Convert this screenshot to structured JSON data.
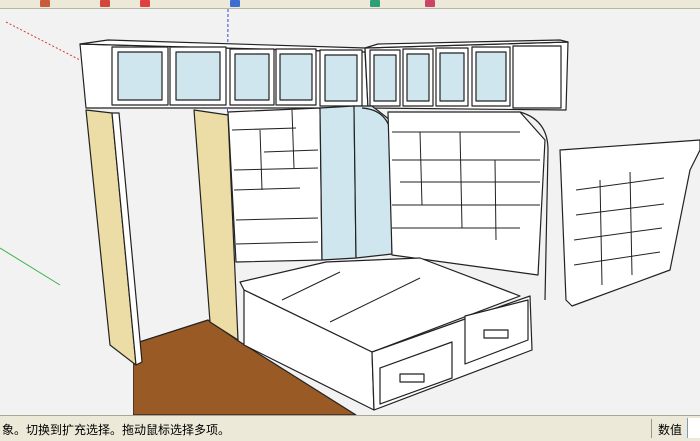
{
  "statusbar": {
    "hint": "象。切换到扩充选择。拖动鼠标选择多项。",
    "measurements_label": "数值",
    "measurements_value": ""
  },
  "toolbar": {
    "icons": [
      "paint-bucket-icon",
      "arrow-icon",
      "move-icon",
      "rotate-icon",
      "orbit-icon",
      "zoom-icon"
    ]
  },
  "scene": {
    "axes": {
      "green": "#3bb24a",
      "red": "#d63a3a",
      "blue": "#3a46d6"
    },
    "colors": {
      "cabinet": "#ffffff",
      "wood_panel": "#ecdca6",
      "floor": "#9a5a26",
      "glass": "#cfe6ee"
    }
  }
}
